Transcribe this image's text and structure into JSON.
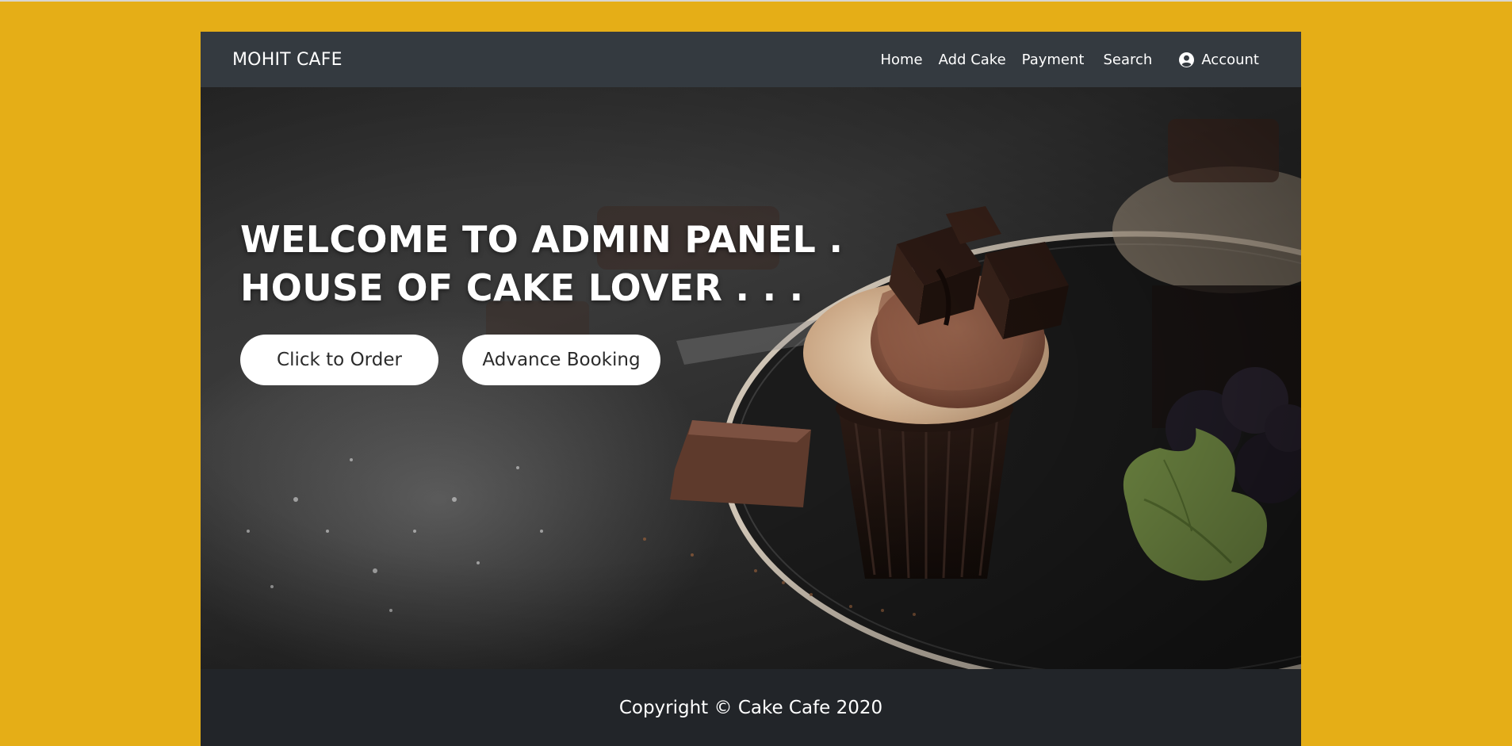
{
  "navbar": {
    "brand": "MOHIT CAFE",
    "links": [
      {
        "label": "Home"
      },
      {
        "label": "Add Cake"
      },
      {
        "label": "Payment"
      },
      {
        "label": "Search"
      }
    ],
    "account": {
      "label": "Account",
      "icon": "user-circle-icon"
    }
  },
  "hero": {
    "title_line1": "WELCOME TO ADMIN PANEL .",
    "title_line2": "HOUSE OF CAKE LOVER . . .",
    "order_button": "Click to Order",
    "advance_button": "Advance Booking"
  },
  "footer": {
    "copyright": "Copyright © Cake Cafe 2020"
  },
  "colors": {
    "page_background": "#e5ae17",
    "navbar": "#343a40",
    "footer": "#222529",
    "button": "#ffffff"
  }
}
